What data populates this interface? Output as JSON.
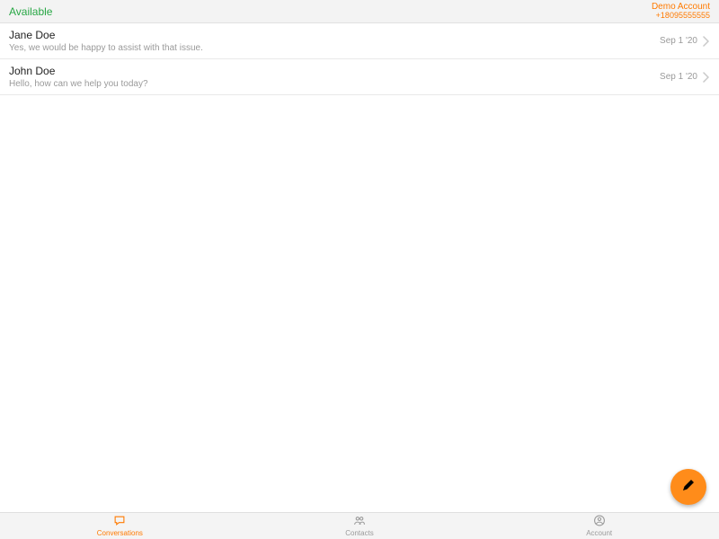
{
  "header": {
    "status": "Available",
    "account_name": "Demo Account",
    "account_phone": "+18095555555"
  },
  "conversations": [
    {
      "name": "Jane Doe",
      "preview": "Yes, we would be happy to assist with that issue.",
      "date": "Sep 1 '20"
    },
    {
      "name": "John Doe",
      "preview": "Hello, how can we help you today?",
      "date": "Sep 1 '20"
    }
  ],
  "tabs": {
    "conversations": "Conversations",
    "contacts": "Contacts",
    "account": "Account"
  }
}
